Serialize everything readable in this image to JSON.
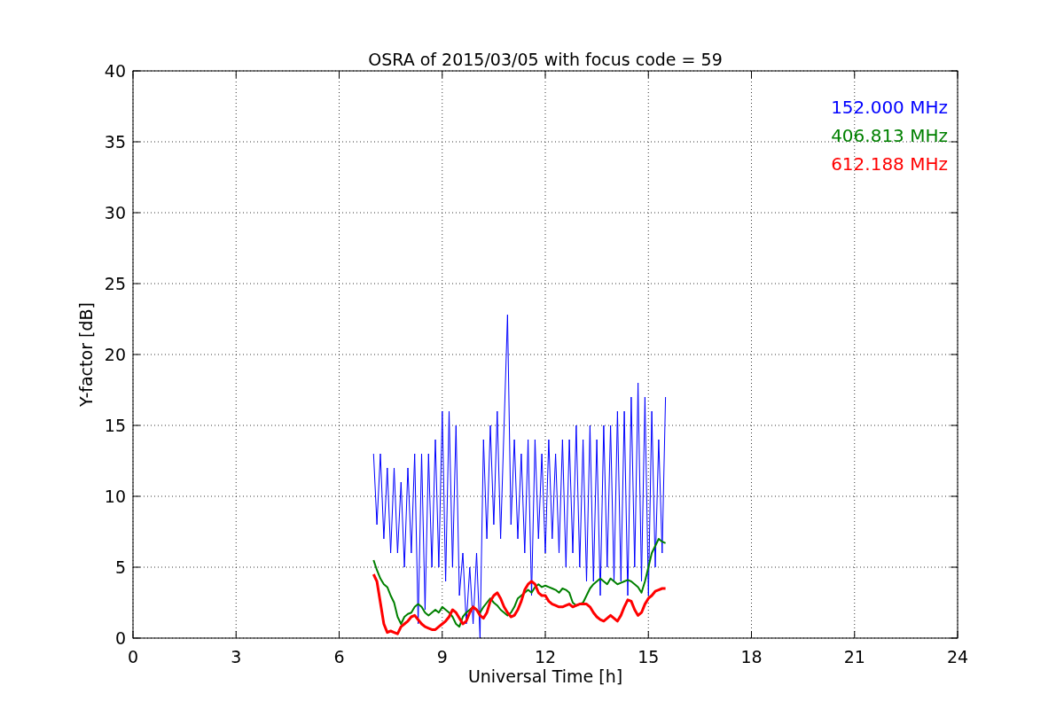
{
  "figure": {
    "chart_data": {
      "type": "line",
      "title": "OSRA of 2015/03/05 with focus code = 59",
      "xlabel": "Universal Time [h]",
      "ylabel": "Y-factor [dB]",
      "xlim": [
        0,
        24
      ],
      "ylim": [
        0,
        40
      ],
      "xticks": [
        0,
        3,
        6,
        9,
        12,
        15,
        18,
        21,
        24
      ],
      "yticks": [
        0,
        5,
        10,
        15,
        20,
        25,
        30,
        35,
        40
      ],
      "grid": true,
      "x": [
        7.0,
        7.1,
        7.2,
        7.3,
        7.4,
        7.5,
        7.6,
        7.7,
        7.8,
        7.9,
        8.0,
        8.1,
        8.2,
        8.3,
        8.4,
        8.5,
        8.6,
        8.7,
        8.8,
        8.9,
        9.0,
        9.1,
        9.2,
        9.3,
        9.4,
        9.5,
        9.6,
        9.7,
        9.8,
        9.9,
        10.0,
        10.1,
        10.2,
        10.3,
        10.4,
        10.5,
        10.6,
        10.7,
        10.8,
        10.9,
        11.0,
        11.1,
        11.2,
        11.3,
        11.4,
        11.5,
        11.6,
        11.7,
        11.8,
        11.9,
        12.0,
        12.1,
        12.2,
        12.3,
        12.4,
        12.5,
        12.6,
        12.7,
        12.8,
        12.9,
        13.0,
        13.1,
        13.2,
        13.3,
        13.4,
        13.5,
        13.6,
        13.7,
        13.8,
        13.9,
        14.0,
        14.1,
        14.2,
        14.3,
        14.4,
        14.5,
        14.6,
        14.7,
        14.8,
        14.9,
        15.0,
        15.1,
        15.2,
        15.3,
        15.4,
        15.5
      ],
      "series": [
        {
          "name": "152.000 MHz",
          "color": "#0000ff",
          "values": [
            13,
            8,
            13,
            7,
            12,
            6,
            12,
            6,
            11,
            5,
            12,
            6,
            13,
            1,
            13,
            2,
            13,
            5,
            14,
            5,
            16,
            4,
            16,
            5,
            15,
            3,
            6,
            1,
            5,
            1,
            6,
            0,
            14,
            7,
            15,
            8,
            16,
            7,
            15,
            22.8,
            8,
            14,
            7,
            13,
            6,
            14,
            3,
            14,
            7,
            13,
            6,
            14,
            7,
            13,
            6,
            14,
            5,
            14,
            6,
            15,
            5,
            14,
            4,
            15,
            4,
            14,
            3,
            15,
            5,
            15,
            4,
            16,
            4,
            16,
            3,
            17,
            5,
            18,
            4,
            17,
            3,
            16,
            5,
            14,
            6,
            17
          ]
        },
        {
          "name": "406.813 MHz",
          "color": "#008000",
          "values": [
            5.5,
            4.8,
            4.2,
            3.8,
            3.6,
            3.0,
            2.5,
            1.5,
            1.0,
            1.5,
            1.7,
            1.8,
            2.2,
            2.4,
            2.2,
            1.8,
            1.6,
            1.8,
            2.0,
            1.8,
            2.2,
            2.0,
            1.8,
            1.5,
            1.0,
            0.8,
            1.5,
            1.8,
            2.0,
            2.2,
            2.0,
            1.8,
            2.2,
            2.5,
            2.8,
            2.5,
            2.3,
            2.0,
            1.8,
            1.6,
            1.8,
            2.2,
            2.8,
            3.0,
            3.2,
            3.4,
            3.2,
            3.6,
            3.8,
            3.6,
            3.7,
            3.6,
            3.5,
            3.4,
            3.2,
            3.5,
            3.4,
            3.2,
            2.5,
            2.3,
            2.4,
            2.5,
            3.0,
            3.5,
            3.8,
            4.0,
            4.2,
            4.0,
            3.8,
            4.2,
            4.0,
            3.8,
            3.9,
            4.0,
            4.1,
            4.0,
            3.8,
            3.6,
            3.2,
            4.0,
            5.0,
            6.0,
            6.5,
            7.0,
            6.8,
            6.7
          ]
        },
        {
          "name": "612.188 MHz",
          "color": "#ff0000",
          "values": [
            4.5,
            4.0,
            2.5,
            1.0,
            0.4,
            0.5,
            0.4,
            0.3,
            0.8,
            1.0,
            1.2,
            1.5,
            1.6,
            1.3,
            1.0,
            0.8,
            0.7,
            0.6,
            0.6,
            0.8,
            1.0,
            1.2,
            1.5,
            2.0,
            1.8,
            1.4,
            1.0,
            1.2,
            1.8,
            2.2,
            2.0,
            1.6,
            1.4,
            1.8,
            2.6,
            3.0,
            3.2,
            2.8,
            2.2,
            1.8,
            1.5,
            1.6,
            2.0,
            2.6,
            3.4,
            3.8,
            4.0,
            3.8,
            3.2,
            3.0,
            3.0,
            2.6,
            2.4,
            2.3,
            2.2,
            2.2,
            2.3,
            2.4,
            2.2,
            2.3,
            2.4,
            2.4,
            2.4,
            2.2,
            1.8,
            1.5,
            1.3,
            1.2,
            1.4,
            1.6,
            1.4,
            1.2,
            1.6,
            2.2,
            2.7,
            2.6,
            2.0,
            1.6,
            1.8,
            2.4,
            2.8,
            3.0,
            3.3,
            3.4,
            3.5,
            3.5
          ]
        }
      ]
    }
  }
}
